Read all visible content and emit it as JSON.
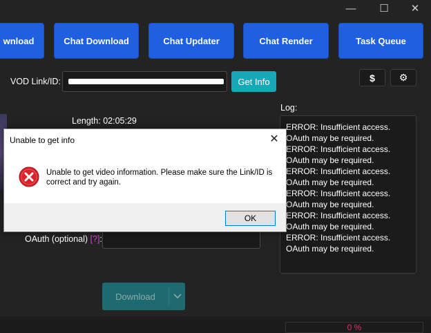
{
  "window": {
    "controls": [
      "minimize-icon",
      "maximize-icon",
      "close-icon"
    ],
    "min_glyph": "—",
    "max_glyph": "☐",
    "close_glyph": "✕"
  },
  "nav": {
    "items": [
      {
        "label": "wnload"
      },
      {
        "label": "Chat Download"
      },
      {
        "label": "Chat Updater"
      },
      {
        "label": "Chat Render"
      },
      {
        "label": "Task Queue"
      }
    ]
  },
  "form": {
    "vod_label": "VOD Link/ID:",
    "vod_value": "",
    "get_info_label": "Get Info",
    "length_label": "Length:",
    "length_value": "02:05:29",
    "oauth_label": "OAuth (optional)",
    "oauth_help": "[?]",
    "oauth_colon": ":",
    "download_label": "Download"
  },
  "toolbar": {
    "donate_glyph": "$",
    "settings_glyph": "⚙"
  },
  "log": {
    "label": "Log:",
    "lines": [
      "ERROR: Insufficient access. OAuth may be required.",
      "ERROR: Insufficient access. OAuth may be required.",
      "ERROR: Insufficient access. OAuth may be required.",
      "ERROR: Insufficient access. OAuth may be required.",
      "ERROR: Insufficient access. OAuth may be required.",
      "ERROR: Insufficient access. OAuth may be required."
    ]
  },
  "dialog": {
    "title": "Unable to get info",
    "close_glyph": "✕",
    "message": "Unable to get video information. Please make sure the Link/ID is correct and try again.",
    "ok_label": "OK"
  },
  "status": {
    "progress_text": "0 %",
    "progress_value": 0
  },
  "colors": {
    "accent": "#1f5fe0",
    "teal": "#17a9b8",
    "help_link": "#e040e0",
    "progress_text": "#e0306a",
    "error_icon": "#d8232a"
  }
}
